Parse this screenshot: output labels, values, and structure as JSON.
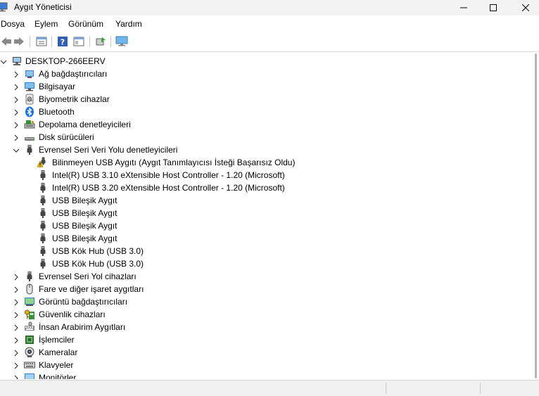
{
  "window": {
    "title": "Aygıt Yöneticisi"
  },
  "menu": [
    "Dosya",
    "Eylem",
    "Görünüm",
    "Yardım"
  ],
  "toolbar": {
    "buttons": [
      "back-icon",
      "forward-icon",
      "properties-icon",
      "help-icon",
      "view-icon",
      "update-driver-icon",
      "monitor-scan-icon"
    ]
  },
  "tree": {
    "root": "DESKTOP-266EERV",
    "categories": [
      {
        "label": "Ağ bağdaştırıcıları",
        "icon": "network-adapter-icon",
        "expanded": false
      },
      {
        "label": "Bilgisayar",
        "icon": "computer-icon",
        "expanded": false
      },
      {
        "label": "Biyometrik cihazlar",
        "icon": "fingerprint-icon",
        "expanded": false
      },
      {
        "label": "Bluetooth",
        "icon": "bluetooth-icon",
        "expanded": false
      },
      {
        "label": "Depolama denetleyicileri",
        "icon": "storage-controller-icon",
        "expanded": false
      },
      {
        "label": "Disk sürücüleri",
        "icon": "disk-drive-icon",
        "expanded": false
      },
      {
        "label": "Evrensel Seri Veri Yolu denetleyicileri",
        "icon": "usb-icon",
        "expanded": true,
        "children": [
          {
            "label": "Bilinmeyen USB Aygıtı (Aygıt Tanımlayıcısı İsteği Başarısız Oldu)",
            "icon": "usb-warning-icon"
          },
          {
            "label": "Intel(R) USB 3.10 eXtensible Host Controller - 1.20 (Microsoft)",
            "icon": "usb-icon"
          },
          {
            "label": "Intel(R) USB 3.20 eXtensible Host Controller - 1.20 (Microsoft)",
            "icon": "usb-icon"
          },
          {
            "label": "USB Bileşik Aygıt",
            "icon": "usb-icon"
          },
          {
            "label": "USB Bileşik Aygıt",
            "icon": "usb-icon"
          },
          {
            "label": "USB Bileşik Aygıt",
            "icon": "usb-icon"
          },
          {
            "label": "USB Bileşik Aygıt",
            "icon": "usb-icon"
          },
          {
            "label": "USB Kök Hub (USB 3.0)",
            "icon": "usb-icon"
          },
          {
            "label": "USB Kök Hub (USB 3.0)",
            "icon": "usb-icon"
          }
        ]
      },
      {
        "label": "Evrensel Seri Yol cihazları",
        "icon": "usb-icon",
        "expanded": false
      },
      {
        "label": "Fare ve diğer işaret aygıtları",
        "icon": "mouse-icon",
        "expanded": false
      },
      {
        "label": "Görüntü bağdaştırıcıları",
        "icon": "display-adapter-icon",
        "expanded": false
      },
      {
        "label": "Güvenlik cihazları",
        "icon": "security-device-icon",
        "expanded": false
      },
      {
        "label": "İnsan Arabirim Aygıtları",
        "icon": "hid-icon",
        "expanded": false
      },
      {
        "label": "İşlemciler",
        "icon": "processor-icon",
        "expanded": false
      },
      {
        "label": "Kameralar",
        "icon": "camera-icon",
        "expanded": false
      },
      {
        "label": "Klavyeler",
        "icon": "keyboard-icon",
        "expanded": false
      },
      {
        "label": "Monitörler",
        "icon": "monitor-icon",
        "expanded": false
      }
    ]
  },
  "colors": {
    "titlebar_bg": "#f3f3f3",
    "usb_icon": "#555555",
    "warning_yellow": "#f5c000",
    "bluetooth_blue": "#1a73e8"
  }
}
